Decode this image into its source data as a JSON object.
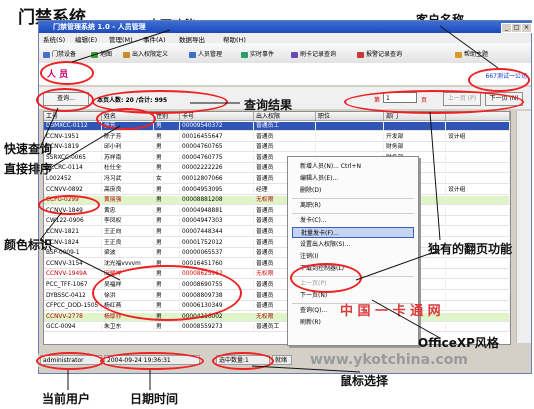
{
  "annotations": {
    "app_name": "门禁系统",
    "page_function": "本页功能",
    "client_name": "客户名称",
    "query_result": "查询结果",
    "quick_query": "快速查询",
    "direct_sort": "直接排序",
    "color_mark": "颜色标识",
    "paging": "独有的翻页功能",
    "officexp_style": "OfficeXP风格",
    "current_user": "当前用户",
    "date_time": "日期时间",
    "mouse_select": "鼠标选择"
  },
  "window": {
    "title": "门禁管理系统 1.0 - 人员管理",
    "min": "_",
    "max": "□",
    "close": "×"
  },
  "menu": [
    "系统(S)",
    "编辑(E)",
    "管理(M)",
    "事件(A)",
    "数据导出",
    "帮助(H)"
  ],
  "toolbar": [
    {
      "label": "门禁设备",
      "icon": "door-device-icon",
      "color": "#4a6fc8"
    },
    {
      "label": "地图",
      "icon": "map-icon",
      "color": "#3a9b3a"
    },
    {
      "label": "出入权限定义",
      "icon": "permission-icon",
      "color": "#c88a2a"
    },
    {
      "label": "人员管理",
      "icon": "people-icon",
      "color": "#3a6fc8"
    },
    {
      "label": "实时事件",
      "icon": "realtime-icon",
      "color": "#2a9b6a"
    },
    {
      "label": "刷卡记录查询",
      "icon": "card-record-icon",
      "color": "#6a4ab8"
    },
    {
      "label": "报警记录查询",
      "icon": "alarm-record-icon",
      "color": "#c83a3a"
    },
    {
      "label": "帮助主题",
      "icon": "help-icon",
      "color": "#d89a2a"
    }
  ],
  "module": {
    "title": "人 员",
    "client": "667测试一公司"
  },
  "query": {
    "button": "查询...",
    "count_label": "本页人数: 20 /合计: 995",
    "page_label": "第",
    "page_value": "1",
    "page_unit": "页",
    "prev": "上一页 (P)",
    "next": "下一页 (N)"
  },
  "columns": [
    "工号",
    "姓名",
    "性别",
    "卡号",
    "出入权限",
    "职位",
    "部门",
    ""
  ],
  "rows": [
    {
      "id": "DSMXCC-0112",
      "name": "张芳",
      "sex": "男",
      "card": "00009540372",
      "perm": "普通员工",
      "job": "",
      "dept": "",
      "note": "",
      "style": "selected"
    },
    {
      "id": "CCNV-1951",
      "name": "陈子芳",
      "sex": "男",
      "card": "00016455647",
      "perm": "普通员",
      "job": "",
      "dept": "开发部",
      "note": "设计组",
      "style": ""
    },
    {
      "id": "CCNV-1819",
      "name": "邱小利",
      "sex": "男",
      "card": "00004760765",
      "perm": "普通员",
      "job": "",
      "dept": "财务部",
      "note": "",
      "style": ""
    },
    {
      "id": "SSRXCC-0065",
      "name": "苏祥南",
      "sex": "男",
      "card": "00004760775",
      "perm": "普通员",
      "job": "",
      "dept": "财务部",
      "note": "",
      "style": ""
    },
    {
      "id": "CCCRC-0114",
      "name": "杜仕全",
      "sex": "男",
      "card": "00002222226",
      "perm": "普通员",
      "job": "",
      "dept": "",
      "note": "",
      "style": ""
    },
    {
      "id": "L002452",
      "name": "冯习武",
      "sex": "女",
      "card": "00012807066",
      "perm": "普通员",
      "job": "",
      "dept": "",
      "note": "",
      "style": ""
    },
    {
      "id": "CCNVV-0892",
      "name": "高庶良",
      "sex": "男",
      "card": "00004953095",
      "perm": "经理",
      "job": "",
      "dept": "开发部",
      "note": "设计组",
      "style": ""
    },
    {
      "id": "CCFG-0299",
      "name": "黄丽强",
      "sex": "男",
      "card": "00008881208",
      "perm": "无权限",
      "job": "",
      "dept": "",
      "note": "",
      "style": "green"
    },
    {
      "id": "CCNVV-1849",
      "name": "黄忠",
      "sex": "男",
      "card": "00004948881",
      "perm": "普通员",
      "job": "",
      "dept": "开发部",
      "note": "",
      "style": ""
    },
    {
      "id": "CW122-0906",
      "name": "李凤权",
      "sex": "男",
      "card": "00004947303",
      "perm": "普通员",
      "job": "",
      "dept": "",
      "note": "",
      "style": ""
    },
    {
      "id": "CCNV-1821",
      "name": "王正向",
      "sex": "男",
      "card": "00007448344",
      "perm": "普通员",
      "job": "",
      "dept": "",
      "note": "",
      "style": ""
    },
    {
      "id": "CCNV-1824",
      "name": "王正良",
      "sex": "男",
      "card": "00001752012",
      "perm": "普通员",
      "job": "",
      "dept": "",
      "note": "",
      "style": ""
    },
    {
      "id": "BSP-0009-1",
      "name": "梁波",
      "sex": "男",
      "card": "00000065537",
      "perm": "普通员",
      "job": "",
      "dept": "",
      "note": "",
      "style": ""
    },
    {
      "id": "CCNVV-3154",
      "name": "沈光福vvvvm",
      "sex": "男",
      "card": "00016451760",
      "perm": "普通员",
      "job": "",
      "dept": "生产部",
      "note": "",
      "style": ""
    },
    {
      "id": "CCNVV-1949A",
      "name": "田耀祥",
      "sex": "男",
      "card": "00008625962",
      "perm": "无权限",
      "job": "",
      "dept": "",
      "note": "",
      "style": "red"
    },
    {
      "id": "PCC_TFF-1067",
      "name": "吴福祥",
      "sex": "男",
      "card": "00008690755",
      "perm": "普通员",
      "job": "",
      "dept": "",
      "note": "",
      "style": ""
    },
    {
      "id": "DYBSSC-0412",
      "name": "徐洪",
      "sex": "男",
      "card": "00008809738",
      "perm": "普通员",
      "job": "",
      "dept": "",
      "note": "",
      "style": ""
    },
    {
      "id": "CFPCC_DOD-1505",
      "name": "杨红燕",
      "sex": "男",
      "card": "00006130349",
      "perm": "普通员",
      "job": "",
      "dept": "",
      "note": "",
      "style": ""
    },
    {
      "id": "CCNVV-2778",
      "name": "杨厚亦",
      "sex": "男",
      "card": "00004116002",
      "perm": "无权限",
      "job": "",
      "dept": "",
      "note": "",
      "style": "green"
    },
    {
      "id": "GCC-0094",
      "name": "朱卫东",
      "sex": "男",
      "card": "00008559273",
      "perm": "普通员工",
      "job": "",
      "dept": "",
      "note": "",
      "style": ""
    }
  ],
  "context_menu": [
    {
      "label": "新增人员(N)...  Ctrl+N",
      "disabled": false,
      "highlight": false
    },
    {
      "label": "编辑人员(E)...",
      "disabled": false,
      "highlight": false
    },
    {
      "label": "删除(D)",
      "disabled": false,
      "highlight": false
    },
    {
      "label": "离职(R)",
      "disabled": false,
      "highlight": false
    },
    {
      "label": "发卡(C)...",
      "disabled": false,
      "highlight": false
    },
    {
      "label": "批量发卡(F)...",
      "disabled": false,
      "highlight": true
    },
    {
      "label": "设置出入权限(S)...",
      "disabled": false,
      "highlight": false
    },
    {
      "label": "注销(I)",
      "disabled": false,
      "highlight": false
    },
    {
      "label": "下载到控制器(L)",
      "disabled": false,
      "highlight": false
    },
    {
      "label": "上一页(P)",
      "disabled": true,
      "highlight": false
    },
    {
      "label": "下一页(N)",
      "disabled": false,
      "highlight": false
    },
    {
      "label": "查询(Q)...",
      "disabled": false,
      "highlight": false
    },
    {
      "label": "刷新(R)",
      "disabled": false,
      "highlight": false
    }
  ],
  "status": {
    "user": "administrator",
    "datetime": "2004-09-24 19:36:31",
    "selected": "选中数量:1",
    "state": "就绪"
  },
  "watermark": {
    "logo": "中 国 一 卡 通 网",
    "url": "www.ykotchina.com"
  }
}
